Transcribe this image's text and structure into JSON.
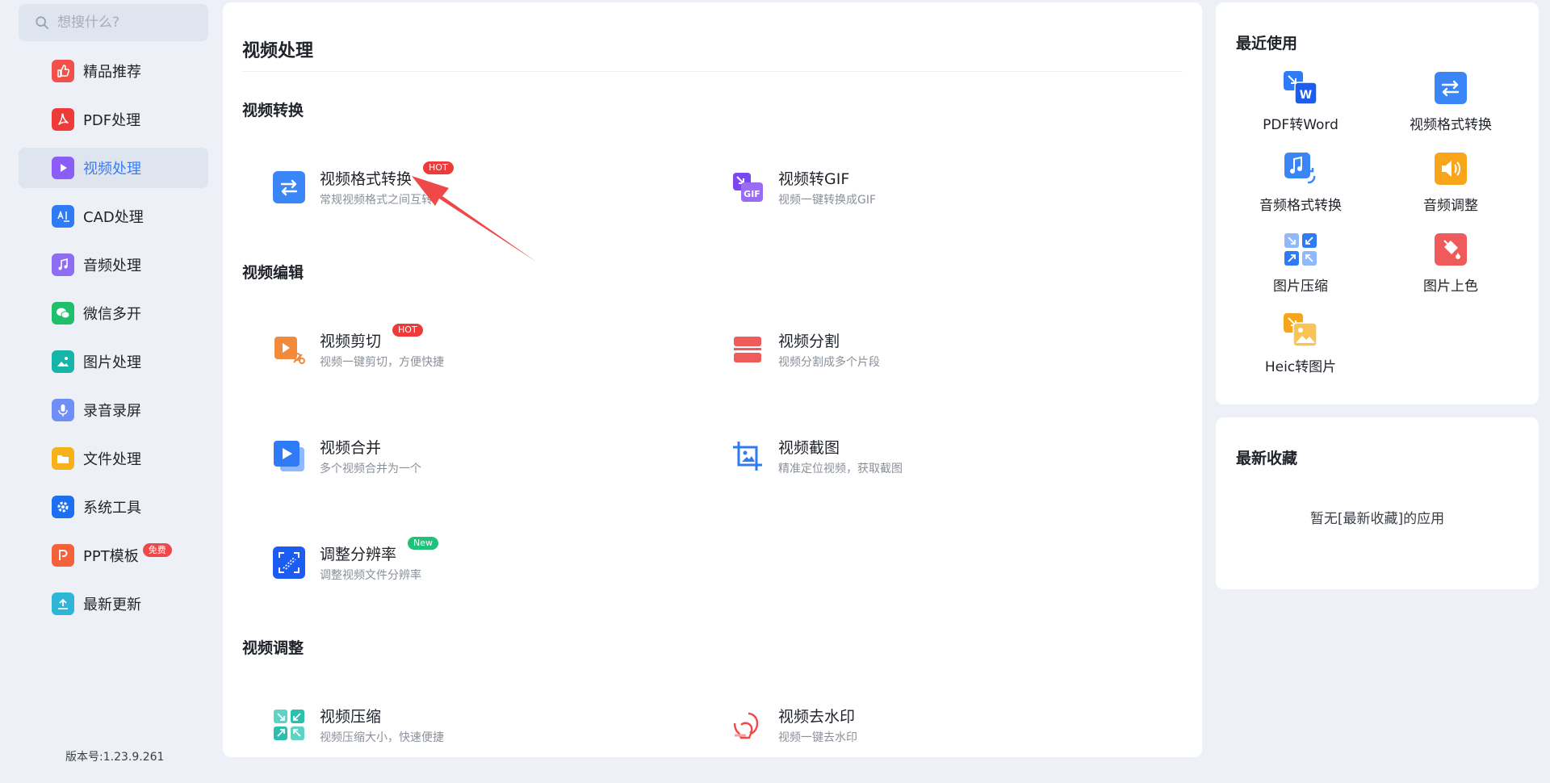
{
  "search": {
    "placeholder": "想搜什么?"
  },
  "sidebar": {
    "items": [
      {
        "label": "精品推荐"
      },
      {
        "label": "PDF处理"
      },
      {
        "label": "视频处理"
      },
      {
        "label": "CAD处理"
      },
      {
        "label": "音频处理"
      },
      {
        "label": "微信多开"
      },
      {
        "label": "图片处理"
      },
      {
        "label": "录音录屏"
      },
      {
        "label": "文件处理"
      },
      {
        "label": "系统工具"
      },
      {
        "label": "PPT模板",
        "badge": "免费"
      },
      {
        "label": "最新更新"
      }
    ],
    "active_index": 2,
    "version": "版本号:1.23.9.261"
  },
  "main": {
    "title": "视频处理",
    "sections": [
      {
        "title": "视频转换",
        "tools": [
          {
            "name": "视频格式转换",
            "desc": "常规视频格式之间互转",
            "badge": "HOT"
          },
          {
            "name": "视频转GIF",
            "desc": "视频一键转换成GIF"
          }
        ]
      },
      {
        "title": "视频编辑",
        "tools": [
          {
            "name": "视频剪切",
            "desc": "视频一键剪切，方便快捷",
            "badge": "HOT"
          },
          {
            "name": "视频分割",
            "desc": "视频分割成多个片段"
          },
          {
            "name": "视频合并",
            "desc": "多个视频合并为一个"
          },
          {
            "name": "视频截图",
            "desc": "精准定位视频，获取截图"
          },
          {
            "name": "调整分辨率",
            "desc": "调整视频文件分辨率",
            "badge": "New"
          }
        ]
      },
      {
        "title": "视频调整",
        "tools": [
          {
            "name": "视频压缩",
            "desc": "视频压缩大小，快速便捷"
          },
          {
            "name": "视频去水印",
            "desc": "视频一键去水印"
          }
        ]
      }
    ]
  },
  "recent": {
    "title": "最近使用",
    "items": [
      {
        "label": "PDF转Word"
      },
      {
        "label": "视频格式转换"
      },
      {
        "label": "音频格式转换"
      },
      {
        "label": "音频调整"
      },
      {
        "label": "图片压缩"
      },
      {
        "label": "图片上色"
      },
      {
        "label": "Heic转图片"
      }
    ]
  },
  "favorites": {
    "title": "最新收藏",
    "empty_text": "暂无[最新收藏]的应用"
  },
  "colors": {
    "accent": "#3a7bf6",
    "hot": "#ef3a3a",
    "new": "#1fc27a",
    "background": "#edf1f7"
  }
}
